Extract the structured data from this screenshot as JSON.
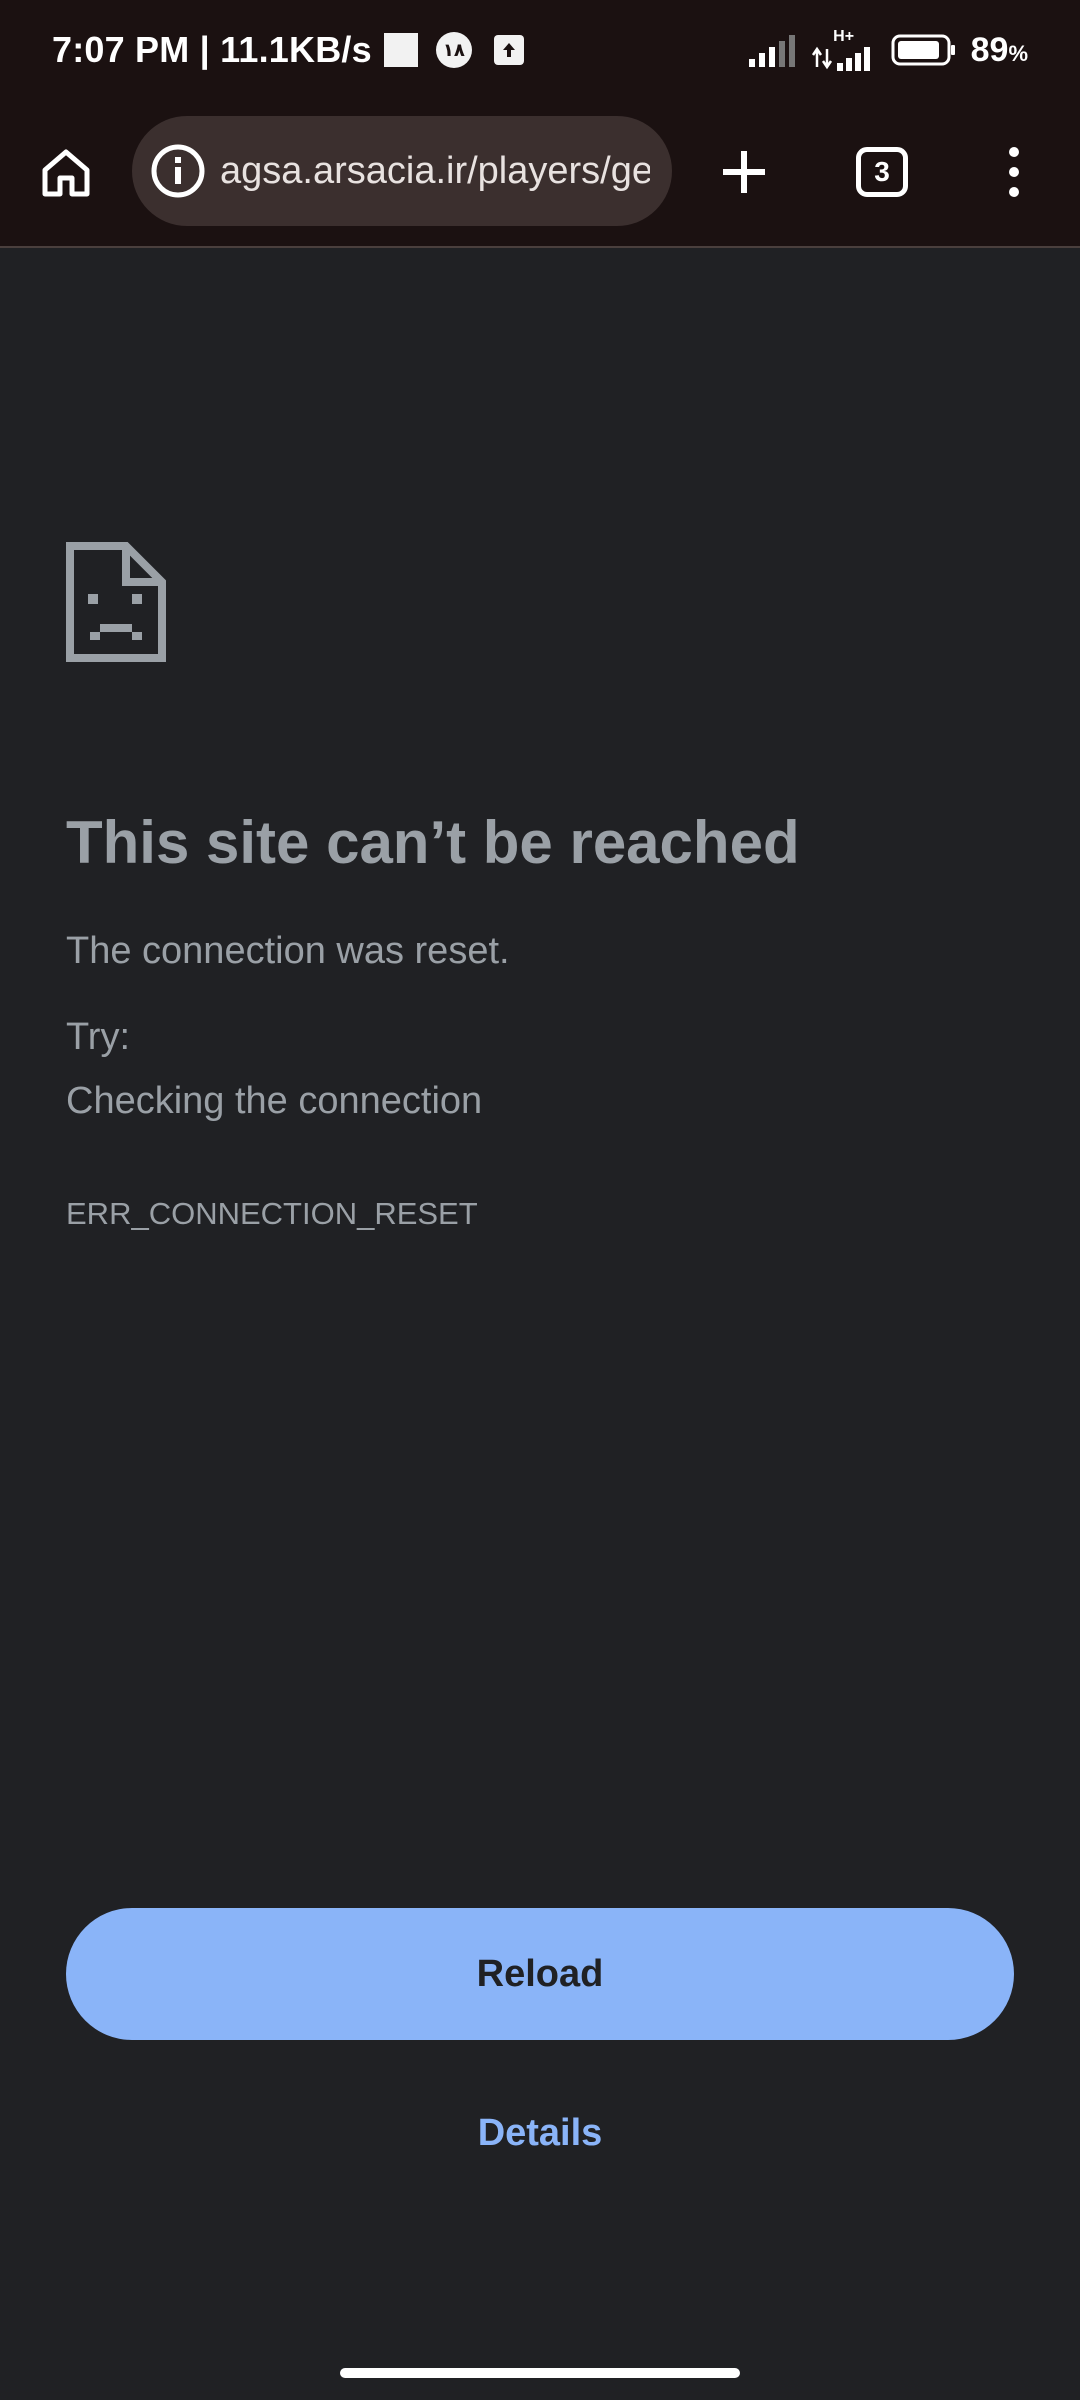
{
  "status_bar": {
    "time_speed": "7:07 PM | 11.1KB/s",
    "notification_badge": "۱۸",
    "network_label": "H+",
    "battery_percent": "89",
    "battery_unit": "%",
    "battery_level": 0.89
  },
  "toolbar": {
    "url": "agsa.arsacia.ir/players/ge",
    "tab_count": "3",
    "icons": [
      "home-icon",
      "info-icon",
      "plus-icon",
      "tabs-icon",
      "more-vert-icon"
    ]
  },
  "error_page": {
    "icon": "sad-page-icon",
    "headline": "This site can’t be reached",
    "description": "The connection was reset.",
    "try_label": "Try:",
    "suggestion": "Checking the connection",
    "error_code": "ERR_CONNECTION_RESET",
    "reload_label": "Reload",
    "details_label": "Details"
  },
  "colors": {
    "page_bg": "#202124",
    "toolbar_bg": "#1b1111",
    "omnibox_bg": "#3b2f2e",
    "text_muted": "#9aa0a6",
    "accent": "#8ab4f8"
  }
}
